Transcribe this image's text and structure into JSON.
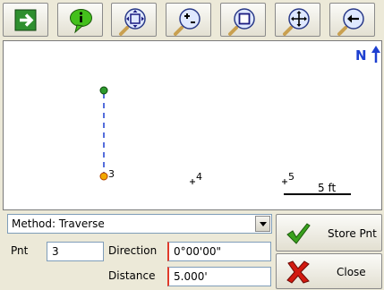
{
  "toolbar": {
    "buttons": [
      {
        "name": "exit-arrow-icon"
      },
      {
        "name": "info-balloon-icon"
      },
      {
        "name": "zoom-extents-icon"
      },
      {
        "name": "zoom-in-out-icon"
      },
      {
        "name": "zoom-window-icon"
      },
      {
        "name": "pan-icon"
      },
      {
        "name": "zoom-previous-icon"
      }
    ]
  },
  "map": {
    "north_label": "N",
    "points": [
      {
        "id": "",
        "role": "start"
      },
      {
        "id": "3",
        "role": "current"
      },
      {
        "id": "4",
        "role": "plus"
      },
      {
        "id": "5",
        "role": "plus"
      }
    ],
    "scale_label": "5 ft",
    "colors": {
      "line": "#1d3fd0",
      "start_point": "#2e9a2e",
      "current_point": "#f2a900",
      "north": "#1d3fd0"
    }
  },
  "form": {
    "method_label": "Method: Traverse",
    "pnt_label": "Pnt",
    "pnt_value": "3",
    "direction_label": "Direction",
    "direction_value": "0°00'00\"",
    "distance_label": "Distance",
    "distance_value": "5.000'"
  },
  "actions": {
    "store_label": "Store Pnt",
    "close_label": "Close"
  }
}
